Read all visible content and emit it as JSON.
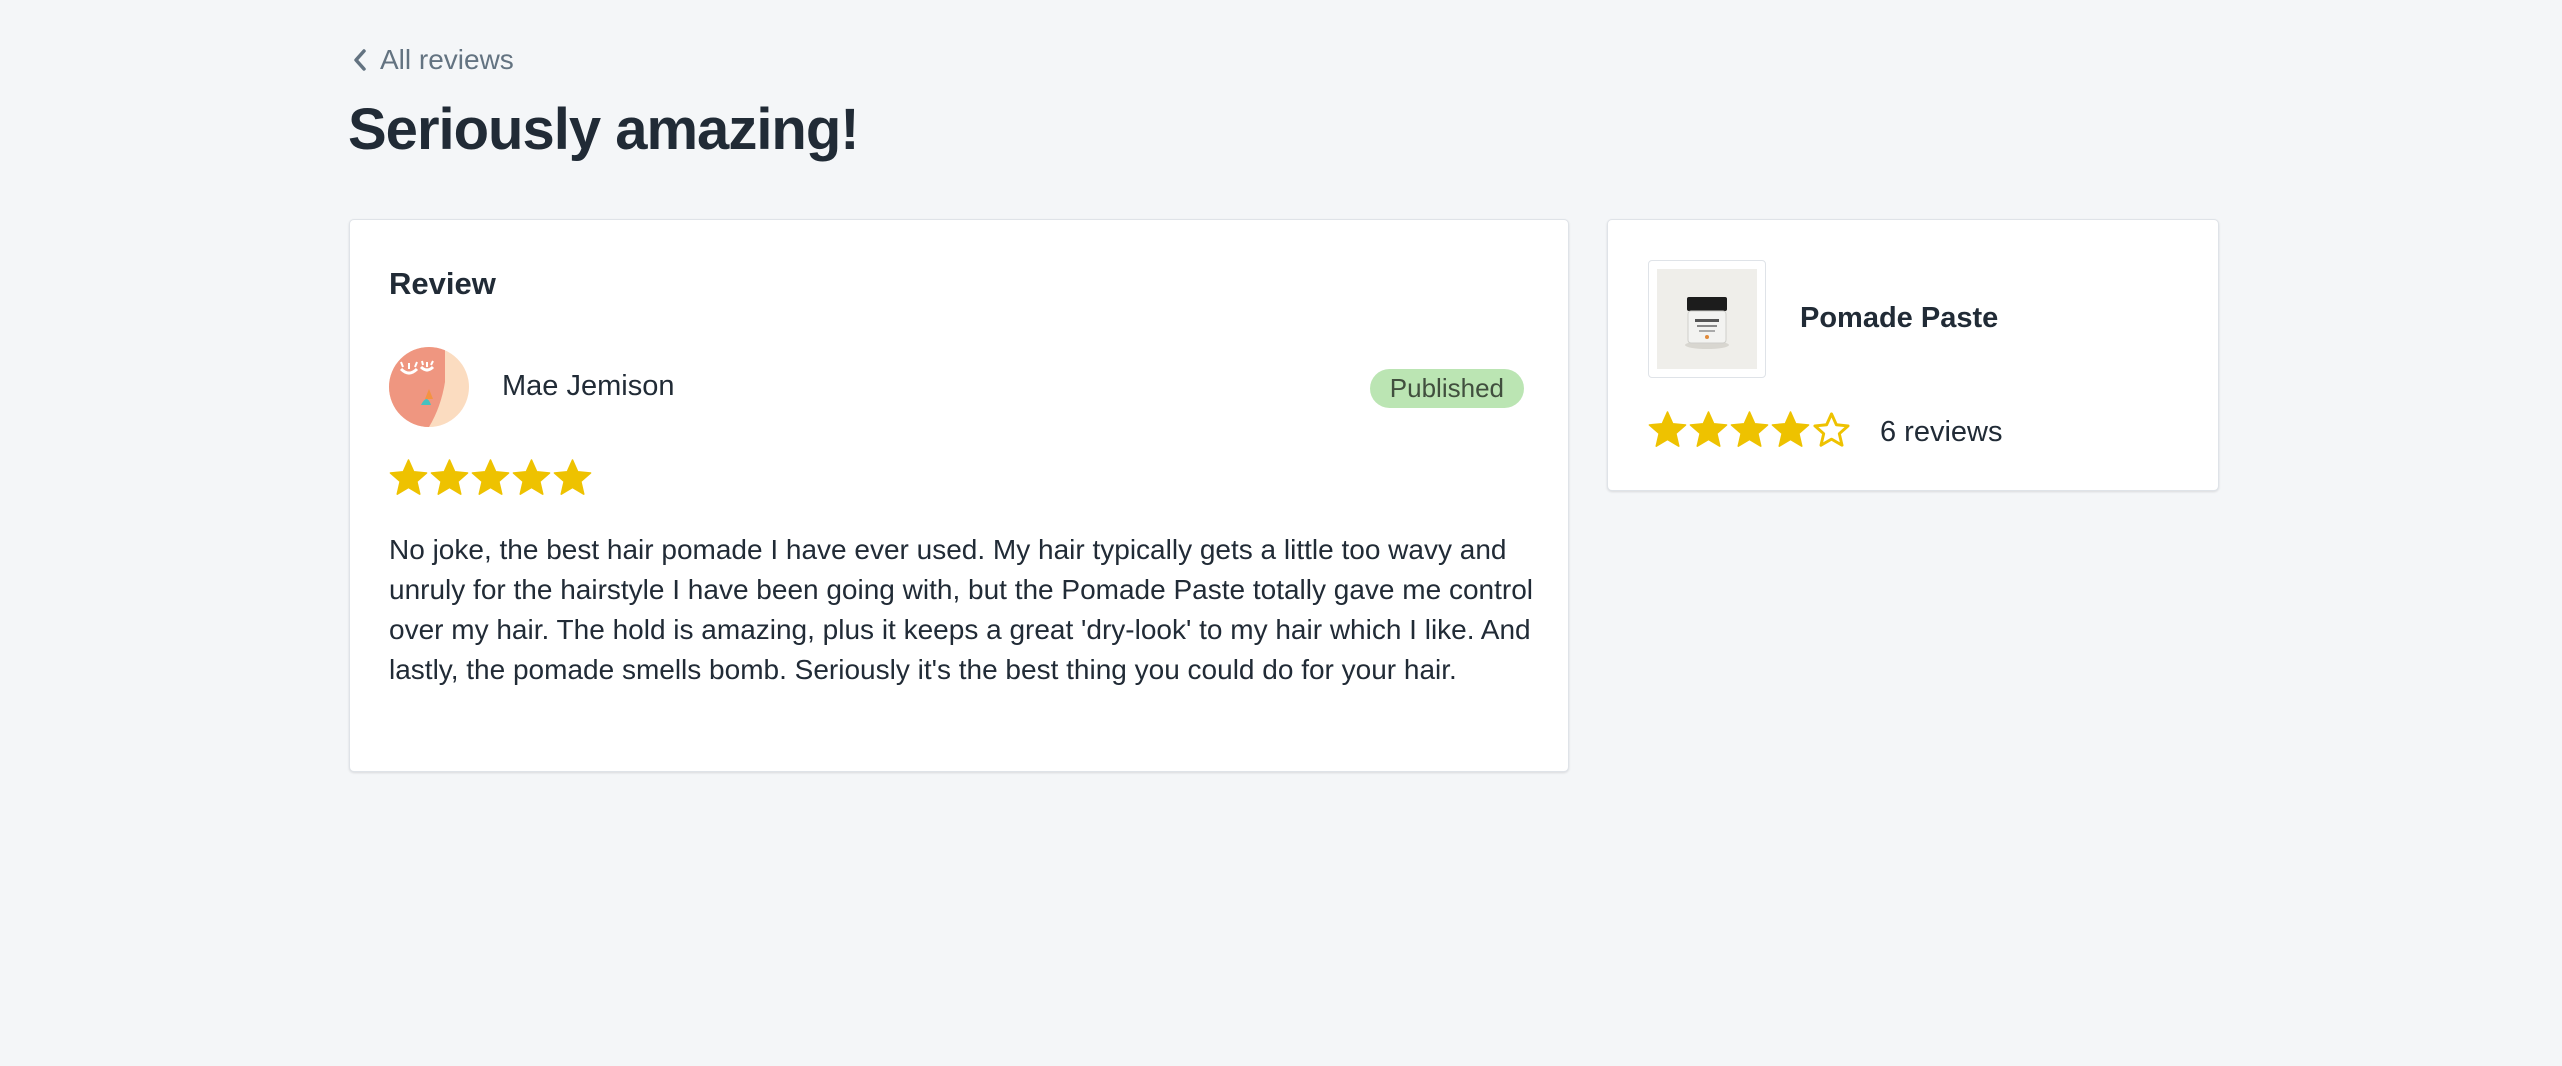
{
  "nav": {
    "back_label": "All reviews"
  },
  "page": {
    "title": "Seriously amazing!"
  },
  "review": {
    "heading": "Review",
    "reviewer_name": "Mae Jemison",
    "status": "Published",
    "rating": 5,
    "max_rating": 5,
    "body": "No joke, the best hair pomade I have ever used. My hair typically gets a little too wavy and unruly for the hairstyle I have been going with, but the Pomade Paste totally gave me control over my hair. The hold is amazing, plus it keeps a great 'dry-look' to my hair which I like. And lastly, the pomade smells bomb. Seriously it's the best thing you could do for your hair."
  },
  "product": {
    "name": "Pomade Paste",
    "rating": 4,
    "max_rating": 5,
    "reviews_count": "6 reviews"
  },
  "colors": {
    "background": "#f4f6f8",
    "star": "#eec200",
    "badge_published": "#bbe5b3",
    "text": "#212b36",
    "subdued": "#637381"
  },
  "icons": {
    "back": "chevron-left-icon",
    "star_filled": "star-filled-icon",
    "star_empty": "star-outline-icon"
  }
}
